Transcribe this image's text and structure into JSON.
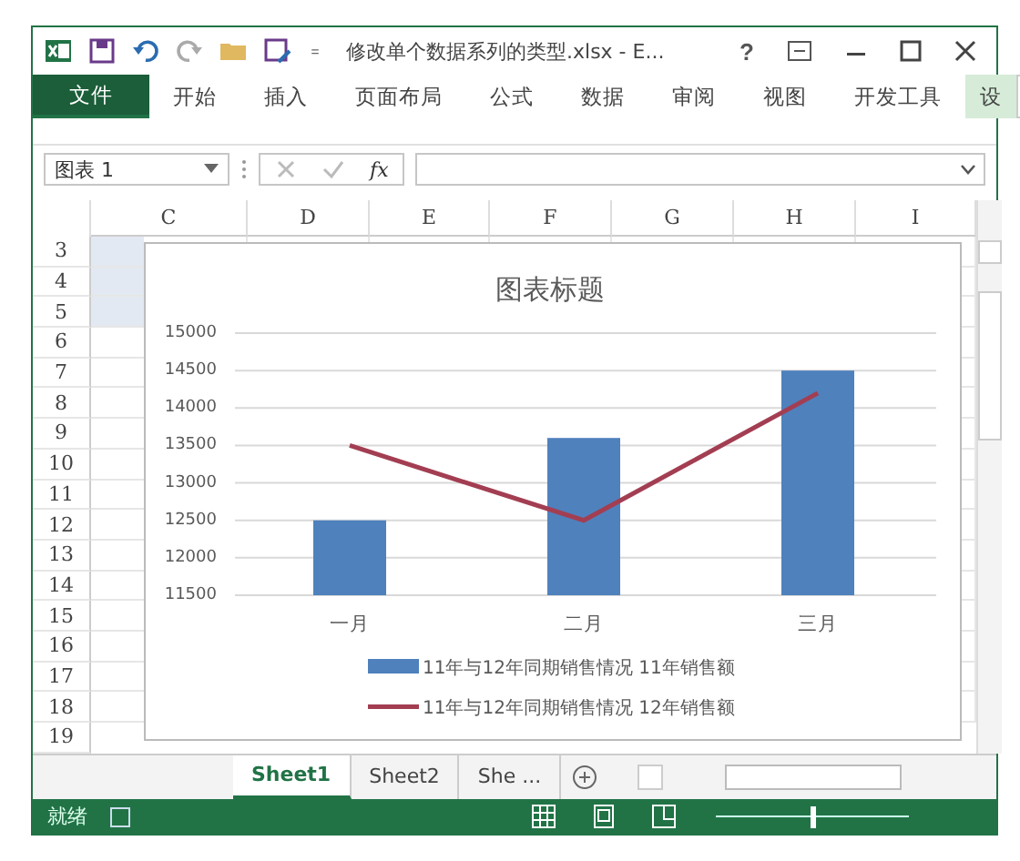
{
  "window": {
    "title": "修改单个数据系列的类型.xlsx - E...",
    "help": "?"
  },
  "ribbon_tabs": [
    {
      "label": "文件",
      "selected": true,
      "kind": "file"
    },
    {
      "label": "开始",
      "selected": false,
      "kind": "tab"
    },
    {
      "label": "插入",
      "selected": false,
      "kind": "tab"
    },
    {
      "label": "页面布局",
      "selected": false,
      "kind": "tab"
    },
    {
      "label": "公式",
      "selected": false,
      "kind": "tab"
    },
    {
      "label": "数据",
      "selected": false,
      "kind": "tab"
    },
    {
      "label": "审阅",
      "selected": false,
      "kind": "tab"
    },
    {
      "label": "视图",
      "selected": false,
      "kind": "tab"
    },
    {
      "label": "开发工具",
      "selected": false,
      "kind": "tab"
    },
    {
      "label": "设",
      "selected": false,
      "kind": "context"
    }
  ],
  "formula_bar": {
    "name_box": "图表 1",
    "function_button": "fx"
  },
  "columns": [
    "C",
    "D",
    "E",
    "F",
    "G",
    "H",
    "I"
  ],
  "rows": [
    "3",
    "4",
    "5",
    "6",
    "7",
    "8",
    "9",
    "10",
    "11",
    "12",
    "13",
    "14",
    "15",
    "16",
    "17",
    "18",
    "19"
  ],
  "chart": {
    "chart_data": {
      "type": "bar",
      "title": "图表标题",
      "categories": [
        "一月",
        "二月",
        "三月"
      ],
      "grid": true,
      "legend": true,
      "ylim": [
        11500,
        15000
      ],
      "yticks": [
        11500,
        12000,
        12500,
        13000,
        13500,
        14000,
        14500,
        15000
      ],
      "series": [
        {
          "name": "11年与12年同期销售情况 11年销售额",
          "color": "#4f81bd",
          "type": "bar",
          "values": [
            12500,
            13600,
            14500
          ]
        },
        {
          "name": "11年与12年同期销售情况 12年销售额",
          "color": "#a33e52",
          "type": "line",
          "values": [
            13500,
            12500,
            14200
          ]
        }
      ]
    }
  },
  "sheet_tabs": [
    {
      "label": "Sheet1",
      "selected": true
    },
    {
      "label": "Sheet2",
      "selected": false
    },
    {
      "label": "She ...",
      "selected": false
    }
  ],
  "status_bar": {
    "status": "就绪",
    "zoom_slider": {
      "level": 0.5
    }
  }
}
